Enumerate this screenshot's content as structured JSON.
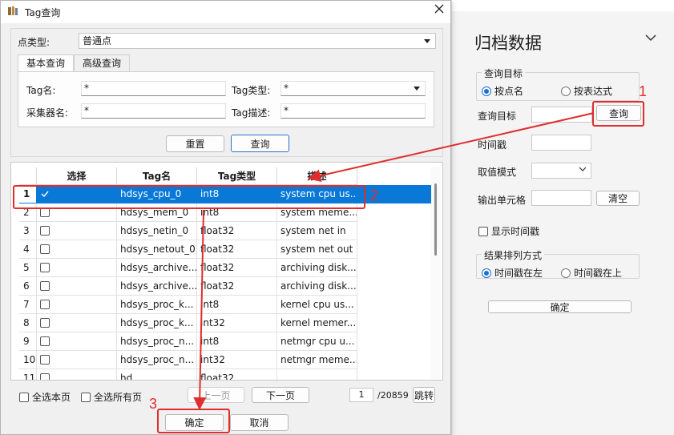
{
  "dialog": {
    "title": "Tag查询",
    "point_type_label": "点类型:",
    "point_type_value": "普通点",
    "tabs": [
      "基本查询",
      "高级查询"
    ],
    "fields": {
      "tag_name_label": "Tag名:",
      "tag_name_value": "*",
      "tag_type_label": "Tag类型:",
      "tag_type_value": "*",
      "collector_label": "采集器名:",
      "collector_value": "*",
      "tag_desc_label": "Tag描述:",
      "tag_desc_value": "*"
    },
    "reset_label": "重置",
    "query_label": "查询",
    "columns": [
      "选择",
      "Tag名",
      "Tag类型",
      "描述"
    ],
    "rows": [
      {
        "n": "1",
        "checked": true,
        "name": "hdsys_cpu_0",
        "type": "int8",
        "desc": "system cpu us..."
      },
      {
        "n": "2",
        "checked": false,
        "name": "hdsys_mem_0",
        "type": "int8",
        "desc": "system meme..."
      },
      {
        "n": "3",
        "checked": false,
        "name": "hdsys_netin_0",
        "type": "float32",
        "desc": "system net in"
      },
      {
        "n": "4",
        "checked": false,
        "name": "hdsys_netout_0",
        "type": "float32",
        "desc": "system net out"
      },
      {
        "n": "5",
        "checked": false,
        "name": "hdsys_archive...",
        "type": "float32",
        "desc": "archiving disk..."
      },
      {
        "n": "6",
        "checked": false,
        "name": "hdsys_archive...",
        "type": "float32",
        "desc": "archiving disk..."
      },
      {
        "n": "7",
        "checked": false,
        "name": "hdsys_proc_k...",
        "type": "int8",
        "desc": "kernel cpu us..."
      },
      {
        "n": "8",
        "checked": false,
        "name": "hdsys_proc_k...",
        "type": "int32",
        "desc": "kernel memer..."
      },
      {
        "n": "9",
        "checked": false,
        "name": "hdsys_proc_n...",
        "type": "int8",
        "desc": "netmgr cpu u..."
      },
      {
        "n": "10",
        "checked": false,
        "name": "hdsys_proc_n...",
        "type": "int32",
        "desc": "netmgr meme..."
      },
      {
        "n": "11",
        "checked": false,
        "name": "hd...",
        "type": "float32",
        "desc": "..."
      }
    ],
    "select_page_label": "全选本页",
    "select_all_label": "全选所有页",
    "prev_label": "上一页",
    "next_label": "下一页",
    "page_value": "1",
    "page_total": "/20859",
    "jump_label": "跳转",
    "ok_label": "确定",
    "cancel_label": "取消"
  },
  "archive_panel": {
    "title": "归档数据",
    "query_target_group": "查询目标",
    "by_name": "按点名",
    "by_expr": "按表达式",
    "query_target_label": "查询目标",
    "query_button": "查询",
    "timestamp_label": "时间戳",
    "value_mode_label": "取值模式",
    "output_cell_label": "输出单元格",
    "clear_button": "清空",
    "show_timestamp_label": "显示时间戳",
    "result_order_group": "结果排列方式",
    "ts_left": "时间戳在左",
    "ts_top": "时间戳在上",
    "confirm_button": "确定"
  },
  "annotations": {
    "step1": "1",
    "step2": "2",
    "step3": "3",
    "color": "#e02d2d"
  }
}
